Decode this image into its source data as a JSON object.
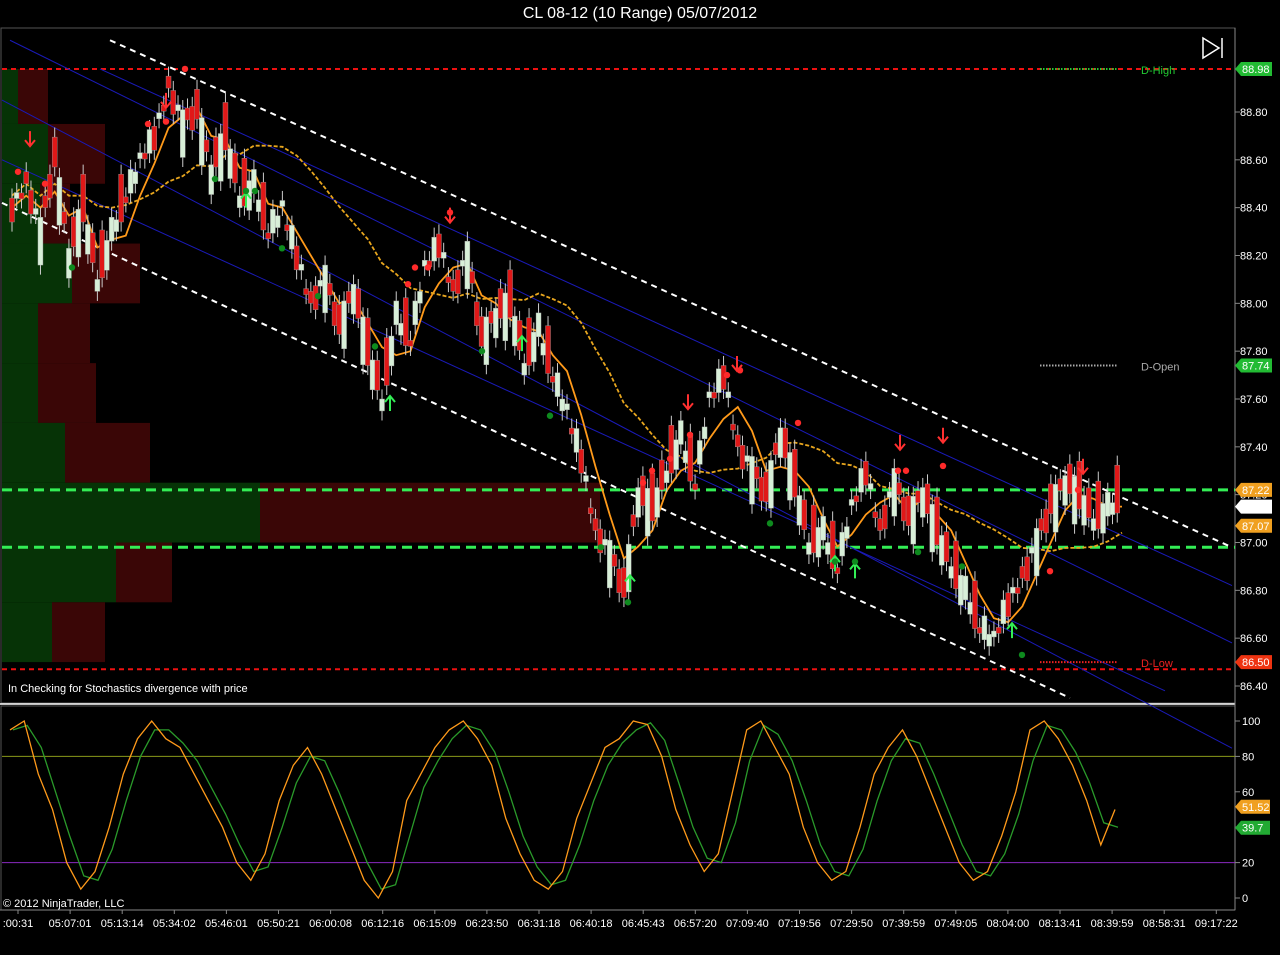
{
  "window": {
    "title": "CL 08-12 (10 Range)  05/07/2012"
  },
  "annotation": "In  Checking for Stochastics  divergence with price",
  "copyright": "© 2012 NinjaTrader, LLC",
  "colors": {
    "background": "#000000",
    "bull_candle": "#d8efd8",
    "bear_candle": "#e01818",
    "fast_ma": "#ff9a1a",
    "slow_ma": "#e8a61e",
    "channel": "#ffffff",
    "regression": "#1a1ab8",
    "levels_green": "#33ee55",
    "levels_red": "#ee1111",
    "stoch_k": "#ff9a1a",
    "stoch_d": "#2a9a2a"
  },
  "chart_data": [
    {
      "type": "candlestick",
      "symbol": "CL 08-12",
      "bar_type": "10 Range",
      "date": "05/07/2012",
      "ylim": [
        86.35,
        89.1
      ],
      "y_ticks": [
        "88.80",
        "88.60",
        "88.40",
        "88.20",
        "88.00",
        "87.80",
        "87.60",
        "87.40",
        "87.20",
        "87.00",
        "86.80",
        "86.60",
        "86.40"
      ],
      "x_ticks": [
        ":00:31",
        "05:07:01",
        "05:13:14",
        "05:34:02",
        "05:46:01",
        "05:50:21",
        "06:00:08",
        "06:12:16",
        "06:15:09",
        "06:23:50",
        "06:31:18",
        "06:40:18",
        "06:45:43",
        "06:57:20",
        "07:09:40",
        "07:19:56",
        "07:29:50",
        "07:39:59",
        "07:49:05",
        "08:04:00",
        "08:13:41",
        "08:39:59",
        "08:58:31",
        "09:17:22"
      ],
      "close_path": [
        88.4,
        88.5,
        88.3,
        88.6,
        88.2,
        88.4,
        88.1,
        88.3,
        88.45,
        88.6,
        88.7,
        88.9,
        88.75,
        88.8,
        88.55,
        88.7,
        88.45,
        88.5,
        88.3,
        88.4,
        88.2,
        88.0,
        88.1,
        87.9,
        88.05,
        87.8,
        87.6,
        87.95,
        87.85,
        88.15,
        88.25,
        88.05,
        88.2,
        87.85,
        87.95,
        88.0,
        87.75,
        87.9,
        87.7,
        87.55,
        87.35,
        87.05,
        86.95,
        86.8,
        87.2,
        87.15,
        87.3,
        87.45,
        87.25,
        87.6,
        87.7,
        87.4,
        87.3,
        87.2,
        87.45,
        87.25,
        87.0,
        87.05,
        86.9,
        87.15,
        87.3,
        87.05,
        87.25,
        87.1,
        87.2,
        87.05,
        86.9,
        86.8,
        86.65,
        86.6,
        86.75,
        86.85,
        87.0,
        87.15,
        87.25,
        87.2,
        87.1,
        87.15,
        87.2
      ],
      "value_labels": [
        {
          "label": "D-High",
          "value": 88.98,
          "color": "#22cc33"
        },
        {
          "label": "D-Open",
          "value": 87.74,
          "color": "#aaaaaa"
        },
        {
          "label": "D-Low",
          "value": 86.5,
          "color": "#ee2222"
        }
      ],
      "price_markers": [
        {
          "text": "88.98",
          "value": 88.98,
          "color": "#22bb33"
        },
        {
          "text": "87.74",
          "value": 87.74,
          "color": "#22bb33"
        },
        {
          "text": "87.22",
          "value": 87.22,
          "color": "#f0a020"
        },
        {
          "text": "87.15",
          "value": 87.15,
          "color": "#ffffff"
        },
        {
          "text": "87.07",
          "value": 87.07,
          "color": "#f0a020"
        },
        {
          "text": "86.50",
          "value": 86.5,
          "color": "#ee3311"
        }
      ],
      "horizontal_levels": {
        "red": [
          88.98,
          86.47
        ],
        "green": [
          87.22,
          86.98
        ]
      }
    },
    {
      "type": "line",
      "name": "Stochastics",
      "ylim": [
        -5,
        105
      ],
      "y_ticks": [
        "100",
        "80",
        "60",
        "40",
        "20",
        "0"
      ],
      "levels": [
        80,
        20
      ],
      "series": [
        {
          "color": "#ff9a1a",
          "values": [
            95,
            100,
            70,
            50,
            20,
            5,
            15,
            40,
            70,
            90,
            100,
            90,
            85,
            70,
            55,
            40,
            20,
            10,
            25,
            55,
            75,
            85,
            70,
            50,
            30,
            10,
            0,
            15,
            55,
            70,
            85,
            95,
            100,
            90,
            75,
            45,
            25,
            10,
            5,
            15,
            45,
            65,
            85,
            90,
            100,
            98,
            80,
            50,
            30,
            15,
            25,
            60,
            95,
            100,
            85,
            70,
            40,
            20,
            10,
            15,
            40,
            70,
            85,
            95,
            80,
            60,
            40,
            20,
            10,
            15,
            35,
            60,
            95,
            100,
            90,
            75,
            55,
            30,
            50
          ]
        }
      ],
      "markers": [
        {
          "text": "51.52",
          "value": 51.52,
          "color": "#f0a020"
        },
        {
          "text": "39.7",
          "value": 39.7,
          "color": "#22aa33"
        }
      ]
    }
  ]
}
